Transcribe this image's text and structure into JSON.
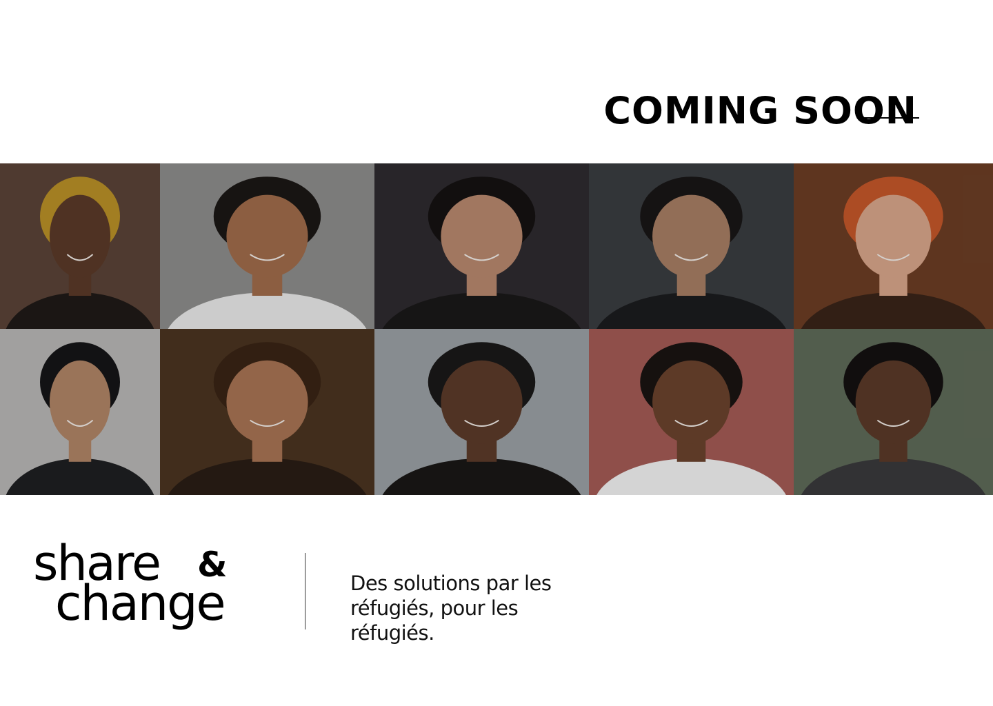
{
  "header": {
    "title": "COMING SOON"
  },
  "photos": [
    {
      "label": "portrait-woman-headwrap",
      "bg": "#5a4337",
      "skin": "#5a3a28",
      "top": "#1f1a17",
      "hair": "#b99027"
    },
    {
      "label": "portrait-man-smiling-marble",
      "bg": "#8d8c8b",
      "skin": "#a06c4a",
      "top": "#e9e9e9",
      "hair": "#1b1715"
    },
    {
      "label": "portrait-woman-laughing",
      "bg": "#2e2b2f",
      "skin": "#b8886e",
      "top": "#1a1818",
      "hair": "#151212"
    },
    {
      "label": "portrait-man-black-hoodie",
      "bg": "#3a3d40",
      "skin": "#a77e64",
      "top": "#1b1c1e",
      "hair": "#181616"
    },
    {
      "label": "portrait-woman-red-hair",
      "bg": "#6b3d24",
      "skin": "#d8a58a",
      "top": "#3a2418",
      "hair": "#c4572a"
    },
    {
      "label": "portrait-man-beanie",
      "bg": "#b8b7b5",
      "skin": "#b08466",
      "top": "#1e1f22",
      "hair": "#151517"
    },
    {
      "label": "portrait-woman-glasses",
      "bg": "#4a3420",
      "skin": "#a87454",
      "top": "#2a1d15",
      "hair": "#3a2415"
    },
    {
      "label": "portrait-man-beard-beanie",
      "bg": "#9aa0a4",
      "skin": "#5c3b2a",
      "top": "#1a1716",
      "hair": "#1a1818"
    },
    {
      "label": "portrait-woman-short-hair",
      "bg": "#a35a55",
      "skin": "#6a422d",
      "top": "#f2f2f2",
      "hair": "#1a1412"
    },
    {
      "label": "portrait-man-curly-hair",
      "bg": "#5e6a58",
      "skin": "#5a3a28",
      "top": "#3a3a3c",
      "hair": "#141111"
    }
  ],
  "brand": {
    "line1": "share",
    "amp": "&",
    "line2": "change"
  },
  "tagline": "Des solutions par les réfugiés, pour les réfugiés."
}
